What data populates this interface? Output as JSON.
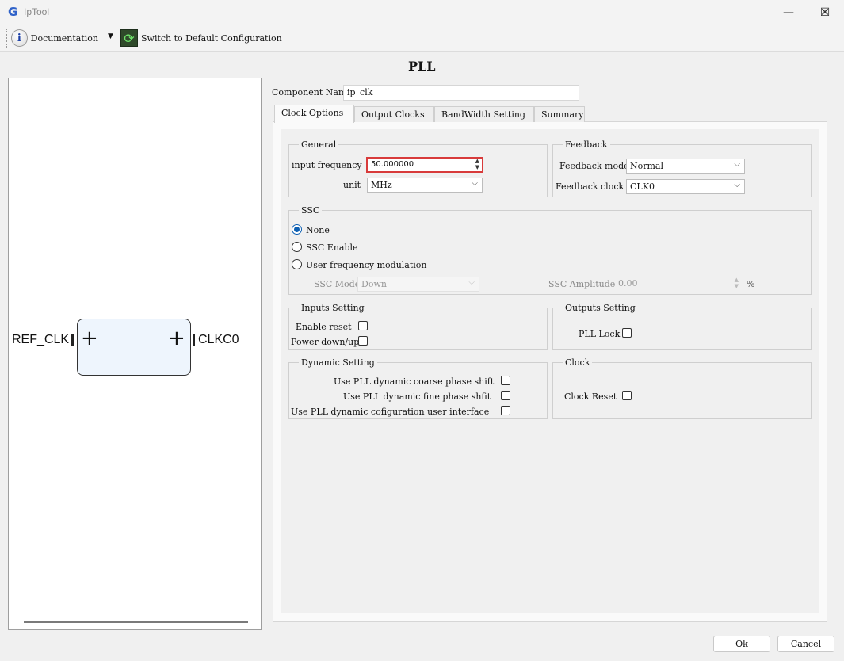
{
  "window": {
    "title": "IpTool",
    "logo": "G",
    "minimize": "—",
    "maximize": "☐",
    "close": "✕"
  },
  "toolbar": {
    "documentation_label": "Documentation",
    "switch_label": "Switch to Default Configuration",
    "info_glyph": "i",
    "refresh_glyph": "⟳",
    "dropdown_glyph": "▼"
  },
  "preview": {
    "input_port": "REF_CLK",
    "output_port": "CLKC0",
    "plus": "+"
  },
  "header": {
    "title": "PLL",
    "component_name_label": "Component Name",
    "component_name_value": "ip_clk"
  },
  "tabs": [
    {
      "label": "Clock Options",
      "active": true
    },
    {
      "label": "Output Clocks",
      "active": false
    },
    {
      "label": "BandWidth Setting",
      "active": false
    },
    {
      "label": "Summary",
      "active": false
    }
  ],
  "general": {
    "legend": "General",
    "input_frequency_label": "input frequency",
    "input_frequency_value": "50.000000",
    "unit_label": "unit",
    "unit_value": "MHz"
  },
  "feedback": {
    "legend": "Feedback",
    "mode_label": "Feedback mode",
    "mode_value": "Normal",
    "clock_label": "Feedback clock",
    "clock_value": "CLK0"
  },
  "ssc": {
    "legend": "SSC",
    "options": [
      {
        "label": "None",
        "selected": true
      },
      {
        "label": "SSC Enable",
        "selected": false
      },
      {
        "label": "User frequency modulation",
        "selected": false
      }
    ],
    "mode_label": "SSC Mode",
    "mode_value": "Down",
    "amplitude_label": "SSC Amplitude",
    "amplitude_value": "0.00",
    "amplitude_unit": "%"
  },
  "inputs_setting": {
    "legend": "Inputs Setting",
    "enable_reset_label": "Enable reset",
    "power_down_label": "Power down/up"
  },
  "outputs_setting": {
    "legend": "Outputs Setting",
    "pll_lock_label": "PLL Lock"
  },
  "dynamic_setting": {
    "legend": "Dynamic Setting",
    "coarse_label": "Use PLL dynamic coarse phase shift",
    "fine_label": "Use PLL dynamic fine phase shfit",
    "config_label": "Use PLL dynamic cofiguration user interface"
  },
  "clock": {
    "legend": "Clock",
    "reset_label": "Clock Reset"
  },
  "footer": {
    "ok_label": "Ok",
    "cancel_label": "Cancel"
  },
  "colors": {
    "accent": "#0c5fb3",
    "highlight_border": "#d83b3b",
    "block_fill": "#eef5fd"
  }
}
